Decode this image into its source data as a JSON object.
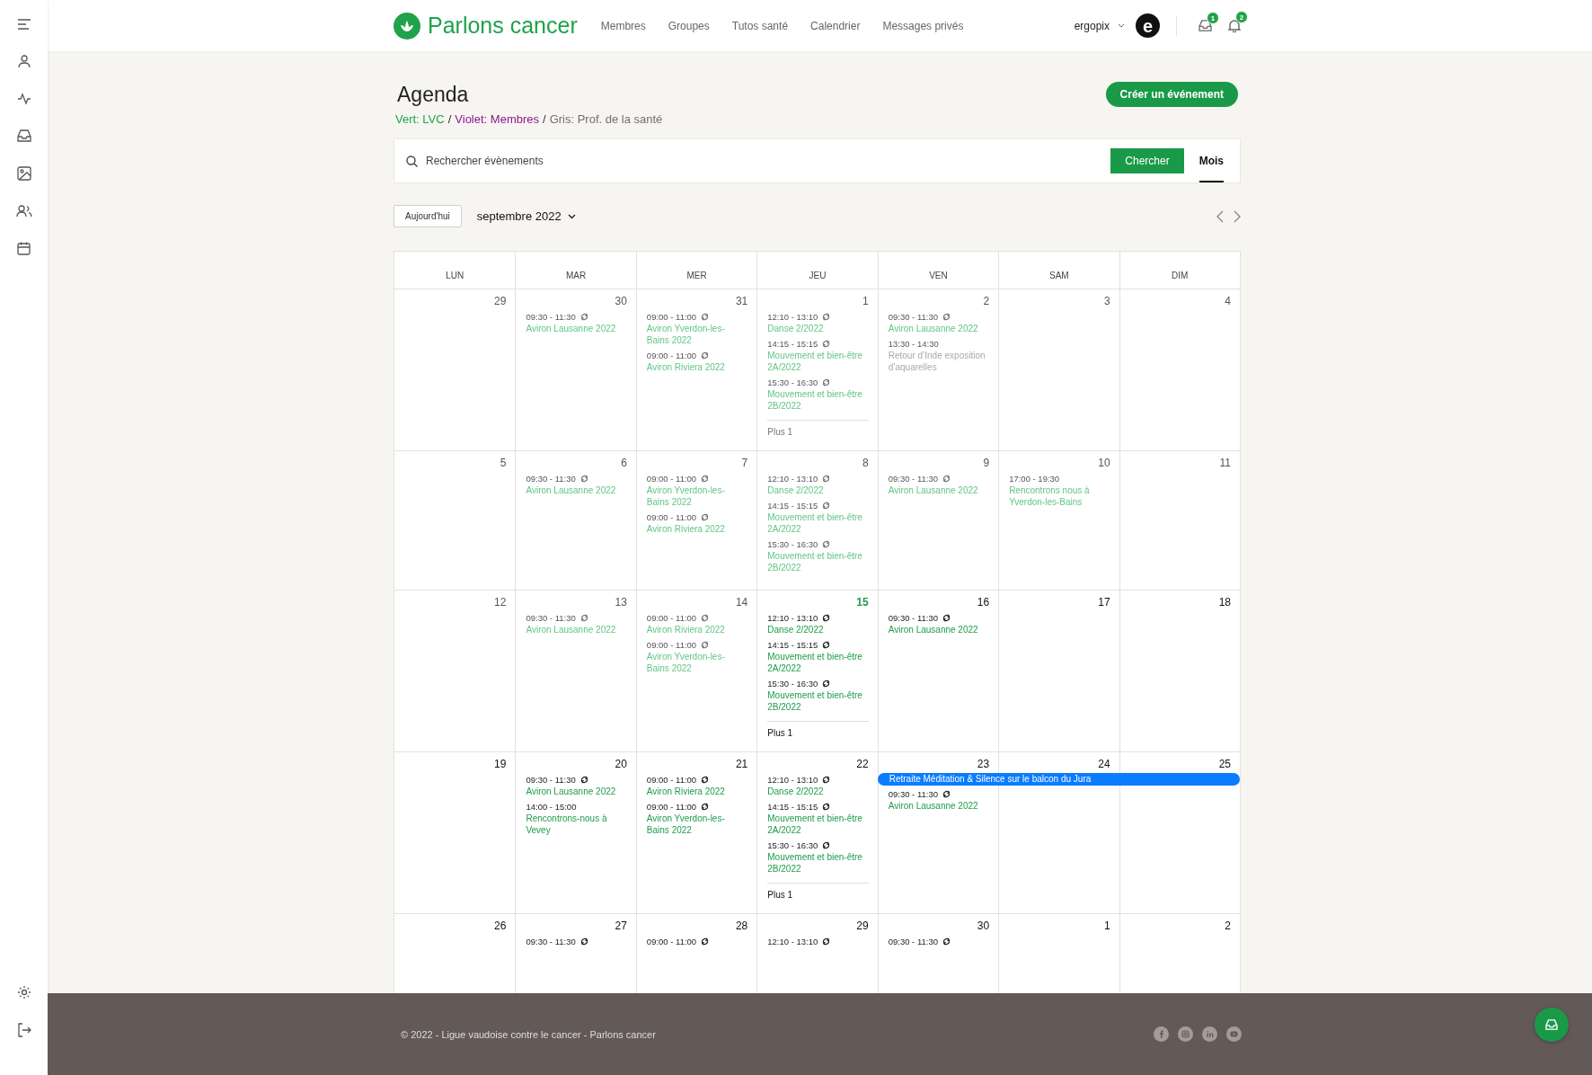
{
  "brand": {
    "name": "Parlons cancer"
  },
  "nav": [
    "Membres",
    "Groupes",
    "Tutos santé",
    "Calendrier",
    "Messages privés"
  ],
  "user": {
    "name": "ergopix",
    "avatar_letter": "e"
  },
  "badges": {
    "inbox": "1",
    "notifications": "2"
  },
  "page": {
    "title": "Agenda",
    "create_button": "Créer un événement"
  },
  "legend": {
    "separator": "/",
    "items": [
      {
        "text": "Vert: LVC",
        "color": "#1fa34a"
      },
      {
        "text": "Violet: Membres",
        "color": "#8b1a8f"
      },
      {
        "text": "Gris: Prof. de la santé",
        "color": "#6f6f6f"
      }
    ]
  },
  "search": {
    "placeholder": "Rechercher évènements",
    "button": "Chercher"
  },
  "views": [
    {
      "label": "Mois",
      "selected": true
    }
  ],
  "toolbar": {
    "today_button": "Aujourd'hui",
    "month": "septembre 2022"
  },
  "weekdays": [
    "LUN",
    "MAR",
    "MER",
    "JEU",
    "VEN",
    "SAM",
    "DIM"
  ],
  "weeks": [
    {
      "days": [
        {
          "day": "29",
          "past": true,
          "today": false
        },
        {
          "day": "30",
          "past": true,
          "today": false,
          "events": [
            {
              "time": "09:30 - 11:30",
              "title": "Aviron Lausanne 2022",
              "recurring": true,
              "kind": "lvc"
            }
          ]
        },
        {
          "day": "31",
          "past": true,
          "today": false,
          "events": [
            {
              "time": "09:00 - 11:00",
              "title": "Aviron Yverdon-les-Bains 2022",
              "recurring": true,
              "kind": "lvc"
            },
            {
              "time": "09:00 - 11:00",
              "title": "Aviron Riviera 2022",
              "recurring": true,
              "kind": "lvc"
            }
          ]
        },
        {
          "day": "1",
          "past": true,
          "today": false,
          "events": [
            {
              "time": "12:10 - 13:10",
              "title": "Danse 2/2022",
              "recurring": true,
              "kind": "lvc"
            },
            {
              "time": "14:15 - 15:15",
              "title": "Mouvement et bien-être 2A/2022",
              "recurring": true,
              "kind": "lvc"
            },
            {
              "time": "15:30 - 16:30",
              "title": "Mouvement et bien-être 2B/2022",
              "recurring": true,
              "kind": "lvc"
            }
          ],
          "more": "Plus 1"
        },
        {
          "day": "2",
          "past": true,
          "today": false,
          "events": [
            {
              "time": "09:30 - 11:30",
              "title": "Aviron Lausanne 2022",
              "recurring": true,
              "kind": "lvc"
            },
            {
              "time": "13:30 - 14:30",
              "title": "Retour d’Inde exposition d’aquarelles",
              "recurring": false,
              "kind": "pro"
            }
          ]
        },
        {
          "day": "3",
          "past": true,
          "today": false
        },
        {
          "day": "4",
          "past": true,
          "today": false
        }
      ]
    },
    {
      "days": [
        {
          "day": "5",
          "past": true,
          "today": false
        },
        {
          "day": "6",
          "past": true,
          "today": false,
          "events": [
            {
              "time": "09:30 - 11:30",
              "title": "Aviron Lausanne 2022",
              "recurring": true,
              "kind": "lvc"
            }
          ]
        },
        {
          "day": "7",
          "past": true,
          "today": false,
          "events": [
            {
              "time": "09:00 - 11:00",
              "title": "Aviron Yverdon-les-Bains 2022",
              "recurring": true,
              "kind": "lvc"
            },
            {
              "time": "09:00 - 11:00",
              "title": "Aviron Riviera 2022",
              "recurring": true,
              "kind": "lvc"
            }
          ]
        },
        {
          "day": "8",
          "past": true,
          "today": false,
          "events": [
            {
              "time": "12:10 - 13:10",
              "title": "Danse 2/2022",
              "recurring": true,
              "kind": "lvc"
            },
            {
              "time": "14:15 - 15:15",
              "title": "Mouvement et bien-être 2A/2022",
              "recurring": true,
              "kind": "lvc"
            },
            {
              "time": "15:30 - 16:30",
              "title": "Mouvement et bien-être 2B/2022",
              "recurring": true,
              "kind": "lvc"
            }
          ]
        },
        {
          "day": "9",
          "past": true,
          "today": false,
          "events": [
            {
              "time": "09:30 - 11:30",
              "title": "Aviron Lausanne 2022",
              "recurring": true,
              "kind": "lvc"
            }
          ]
        },
        {
          "day": "10",
          "past": true,
          "today": false,
          "events": [
            {
              "time": "17:00 - 19:30",
              "title": "Rencontrons nous à Yverdon-les-Bains",
              "recurring": false,
              "kind": "lvc"
            }
          ]
        },
        {
          "day": "11",
          "past": true,
          "today": false
        }
      ]
    },
    {
      "days": [
        {
          "day": "12",
          "past": true,
          "today": false
        },
        {
          "day": "13",
          "past": true,
          "today": false,
          "events": [
            {
              "time": "09:30 - 11:30",
              "title": "Aviron Lausanne 2022",
              "recurring": true,
              "kind": "lvc"
            }
          ]
        },
        {
          "day": "14",
          "past": true,
          "today": false,
          "events": [
            {
              "time": "09:00 - 11:00",
              "title": "Aviron Riviera 2022",
              "recurring": true,
              "kind": "lvc"
            },
            {
              "time": "09:00 - 11:00",
              "title": "Aviron Yverdon-les-Bains 2022",
              "recurring": true,
              "kind": "lvc"
            }
          ]
        },
        {
          "day": "15",
          "past": false,
          "today": true,
          "events": [
            {
              "time": "12:10 - 13:10",
              "title": "Danse 2/2022",
              "recurring": true,
              "kind": "lvc"
            },
            {
              "time": "14:15 - 15:15",
              "title": "Mouvement et bien-être 2A/2022",
              "recurring": true,
              "kind": "lvc"
            },
            {
              "time": "15:30 - 16:30",
              "title": "Mouvement et bien-être 2B/2022",
              "recurring": true,
              "kind": "lvc"
            }
          ],
          "more": "Plus 1"
        },
        {
          "day": "16",
          "past": false,
          "today": false,
          "events": [
            {
              "time": "09:30 - 11:30",
              "title": "Aviron Lausanne 2022",
              "recurring": true,
              "kind": "lvc"
            }
          ]
        },
        {
          "day": "17",
          "past": false,
          "today": false
        },
        {
          "day": "18",
          "past": false,
          "today": false
        }
      ]
    },
    {
      "banner": {
        "title": "Retraite Méditation & Silence sur le balcon du Jura"
      },
      "days": [
        {
          "day": "19",
          "past": false,
          "today": false
        },
        {
          "day": "20",
          "past": false,
          "today": false,
          "events": [
            {
              "time": "09:30 - 11:30",
              "title": "Aviron Lausanne 2022",
              "recurring": true,
              "kind": "lvc"
            },
            {
              "time": "14:00 - 15:00",
              "title": "Rencontrons-nous à Vevey",
              "recurring": false,
              "kind": "lvc"
            }
          ]
        },
        {
          "day": "21",
          "past": false,
          "today": false,
          "events": [
            {
              "time": "09:00 - 11:00",
              "title": "Aviron Riviera 2022",
              "recurring": true,
              "kind": "lvc"
            },
            {
              "time": "09:00 - 11:00",
              "title": "Aviron Yverdon-les-Bains 2022",
              "recurring": true,
              "kind": "lvc"
            }
          ]
        },
        {
          "day": "22",
          "past": false,
          "today": false,
          "events": [
            {
              "time": "12:10 - 13:10",
              "title": "Danse 2/2022",
              "recurring": true,
              "kind": "lvc"
            },
            {
              "time": "14:15 - 15:15",
              "title": "Mouvement et bien-être 2A/2022",
              "recurring": true,
              "kind": "lvc"
            },
            {
              "time": "15:30 - 16:30",
              "title": "Mouvement et bien-être 2B/2022",
              "recurring": true,
              "kind": "lvc"
            }
          ],
          "more": "Plus 1"
        },
        {
          "day": "23",
          "past": false,
          "today": false,
          "banner": true,
          "events": [
            {
              "time": "09:30 - 11:30",
              "title": "Aviron Lausanne 2022",
              "recurring": true,
              "kind": "lvc"
            }
          ]
        },
        {
          "day": "24",
          "past": false,
          "today": false,
          "banner": true
        },
        {
          "day": "25",
          "past": false,
          "today": false,
          "banner": true
        }
      ]
    },
    {
      "days": [
        {
          "day": "26",
          "past": false,
          "today": false
        },
        {
          "day": "27",
          "past": false,
          "today": false,
          "events": [
            {
              "time": "09:30 - 11:30",
              "recurring": true
            }
          ]
        },
        {
          "day": "28",
          "past": false,
          "today": false,
          "events": [
            {
              "time": "09:00 - 11:00",
              "recurring": true
            }
          ]
        },
        {
          "day": "29",
          "past": false,
          "today": false,
          "events": [
            {
              "time": "12:10 - 13:10",
              "recurring": true
            }
          ]
        },
        {
          "day": "30",
          "past": false,
          "today": false,
          "events": [
            {
              "time": "09:30 - 11:30",
              "recurring": true
            }
          ]
        },
        {
          "day": "1",
          "past": false,
          "today": false
        },
        {
          "day": "2",
          "past": false,
          "today": false
        }
      ]
    }
  ],
  "footer": {
    "copyright": "© 2022 - Ligue vaudoise contre le cancer - Parlons cancer"
  }
}
